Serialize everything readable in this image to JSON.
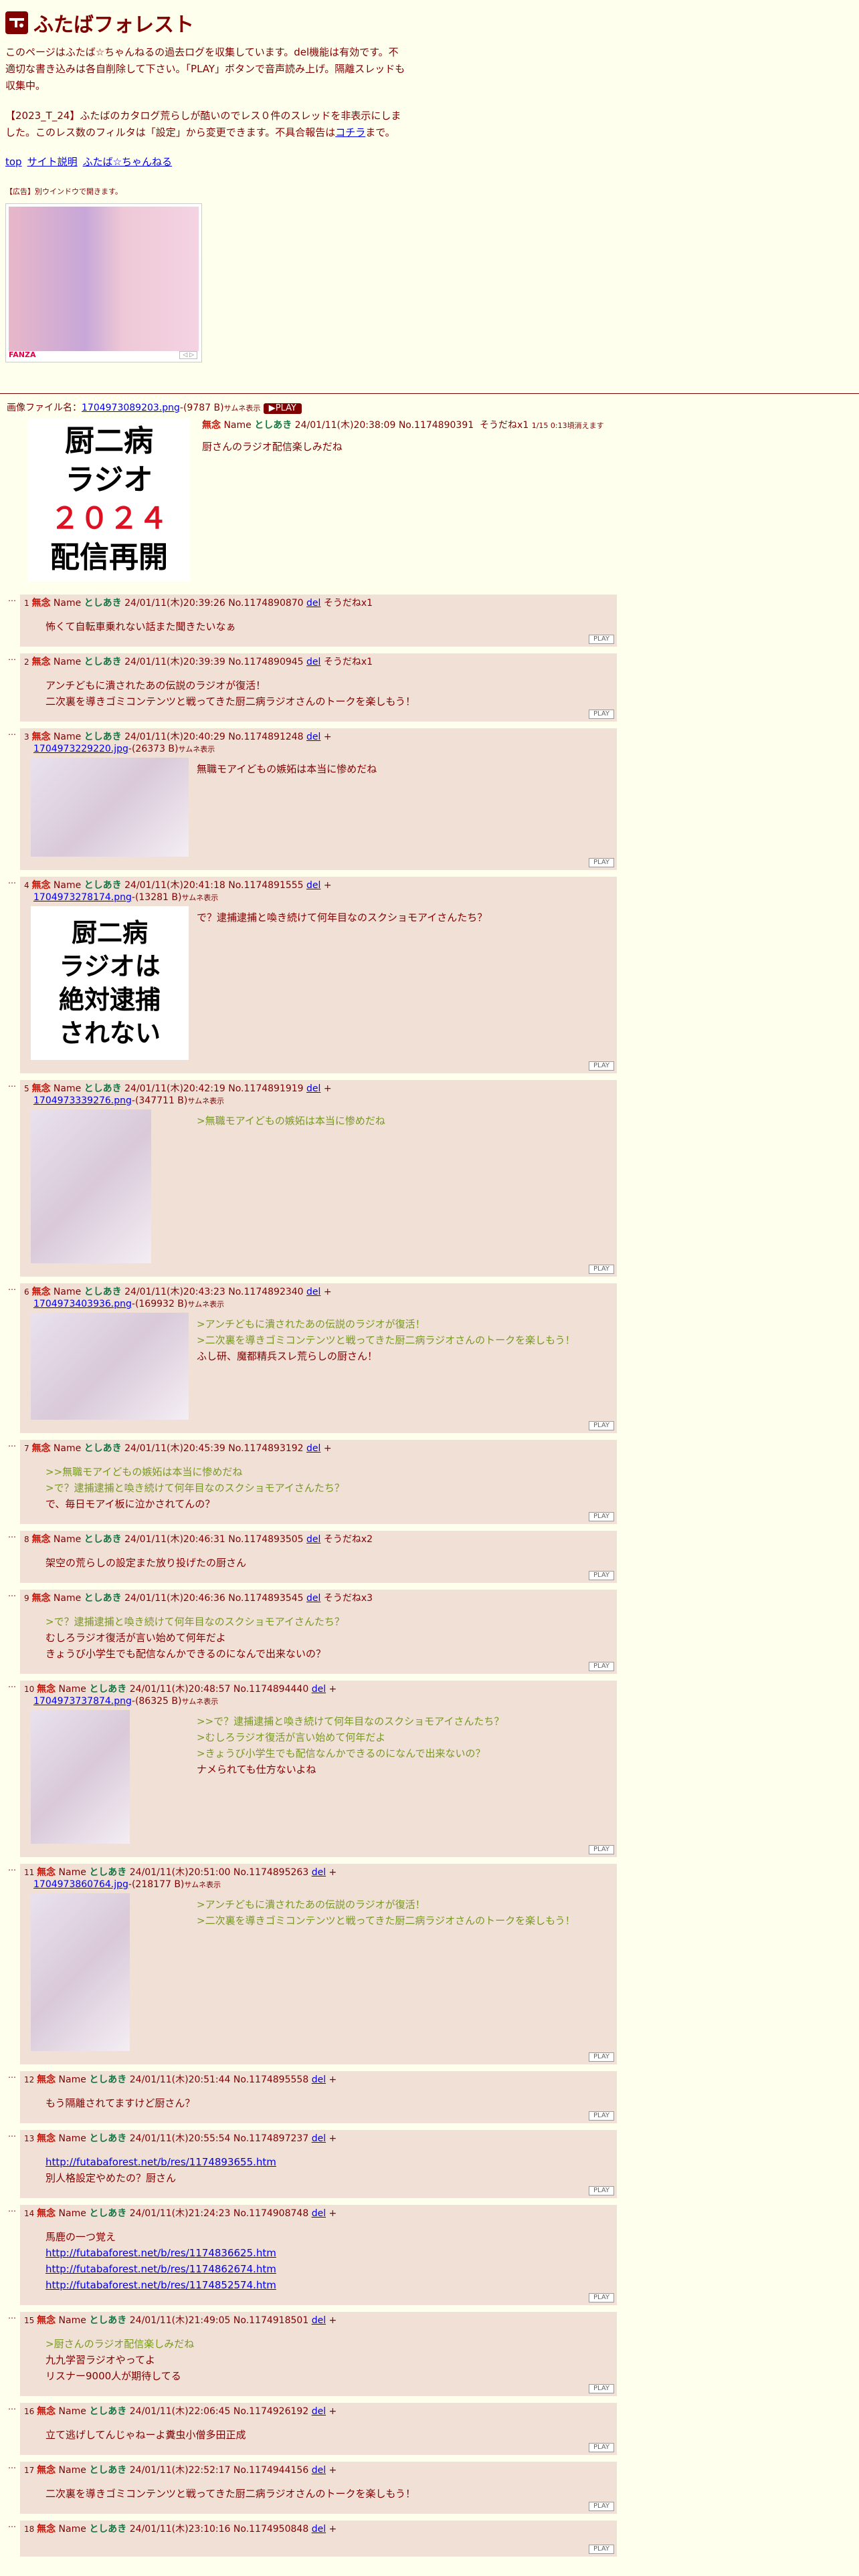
{
  "header": {
    "title": "ふたばフォレスト",
    "intro": "このページはふたば☆ちゃんねるの過去ログを収集しています。del機能は有効です。不適切な書き込みは各自削除して下さい。「PLAY」ボタンで音声読み上げ。隔離スレッドも収集中。",
    "notice": "【2023_T_24】ふたばのカタログ荒らしが酷いのでレス０件のスレッドを非表示にしました。このレス数のフィルタは「設定」から変更できます。不具合報告は",
    "notice_link": "コチラ",
    "notice_end": "まで。",
    "links": [
      "top",
      "サイト説明",
      "ふたば☆ちゃんねる"
    ],
    "ad_label": "【広告】別ウインドウで開きます。",
    "ad_brand": "FANZA"
  },
  "op": {
    "file_label": "画像ファイル名：",
    "file": "1704973089203.png",
    "file_meta": "-(9787 B)",
    "thumb_label": "サムネ表示",
    "play": "▶PLAY",
    "image_lines": [
      "厨二病",
      "ラジオ",
      "２０２４",
      "配信再開"
    ],
    "subject": "無念",
    "name_label": "Name",
    "name": "としあき",
    "date": "24/01/11(木)20:38:09",
    "no": "No.1174890391",
    "sodane": "そうだねx1",
    "expire": "1/15 0:13頃消えます",
    "body": "厨さんのラジオ配信楽しみだね"
  },
  "replies": [
    {
      "n": "1",
      "date": "24/01/11(木)20:39:26",
      "no": "No.1174890870",
      "sodane": "そうだねx1",
      "lines": [
        {
          "t": "怖くて自転車乗れない話また聞きたいなぁ",
          "q": false
        }
      ]
    },
    {
      "n": "2",
      "date": "24/01/11(木)20:39:39",
      "no": "No.1174890945",
      "sodane": "そうだねx1",
      "lines": [
        {
          "t": "アンチどもに潰されたあの伝説のラジオが復活！",
          "q": false
        },
        {
          "t": "二次裏を導きゴミコンテンツと戦ってきた厨二病ラジオさんのトークを楽しもう！",
          "q": false
        }
      ]
    },
    {
      "n": "3",
      "date": "24/01/11(木)20:40:29",
      "no": "No.1174891248",
      "sodane": "+",
      "file": "1704973229220.jpg",
      "meta": "-(26373 B)",
      "lines": [
        {
          "t": "無職モアイどもの嫉妬は本当に惨めだね",
          "q": false
        }
      ]
    },
    {
      "n": "4",
      "date": "24/01/11(木)20:41:18",
      "no": "No.1174891555",
      "sodane": "+",
      "file": "1704973278174.png",
      "meta": "-(13281 B)",
      "img": [
        "厨二病",
        "ラジオは",
        "絶対逮捕",
        "されない"
      ],
      "lines": [
        {
          "t": "で？逮捕逮捕と喚き続けて何年目なのスクショモアイさんたち？",
          "q": false
        }
      ]
    },
    {
      "n": "5",
      "date": "24/01/11(木)20:42:19",
      "no": "No.1174891919",
      "sodane": "+",
      "file": "1704973339276.png",
      "meta": "-(347711 B)",
      "lines": [
        {
          "t": ">無職モアイどもの嫉妬は本当に惨めだね",
          "q": true
        }
      ]
    },
    {
      "n": "6",
      "date": "24/01/11(木)20:43:23",
      "no": "No.1174892340",
      "sodane": "+",
      "file": "1704973403936.png",
      "meta": "-(169932 B)",
      "lines": [
        {
          "t": ">アンチどもに潰されたあの伝説のラジオが復活！",
          "q": true
        },
        {
          "t": ">二次裏を導きゴミコンテンツと戦ってきた厨二病ラジオさんのトークを楽しもう！",
          "q": true
        },
        {
          "t": "ふし研、魔都精兵スレ荒らしの厨さん！",
          "q": false
        }
      ]
    },
    {
      "n": "7",
      "date": "24/01/11(木)20:45:39",
      "no": "No.1174893192",
      "sodane": "+",
      "lines": [
        {
          "t": ">>無職モアイどもの嫉妬は本当に惨めだね",
          "q": true
        },
        {
          "t": ">で？逮捕逮捕と喚き続けて何年目なのスクショモアイさんたち？",
          "q": true
        },
        {
          "t": "で、毎日モアイ板に泣かされてんの？",
          "q": false
        }
      ]
    },
    {
      "n": "8",
      "date": "24/01/11(木)20:46:31",
      "no": "No.1174893505",
      "sodane": "そうだねx2",
      "lines": [
        {
          "t": "架空の荒らしの設定また放り投げたの厨さん",
          "q": false
        }
      ]
    },
    {
      "n": "9",
      "date": "24/01/11(木)20:46:36",
      "no": "No.1174893545",
      "sodane": "そうだねx3",
      "lines": [
        {
          "t": ">で？逮捕逮捕と喚き続けて何年目なのスクショモアイさんたち？",
          "q": true
        },
        {
          "t": "むしろラジオ復活が言い始めて何年だよ",
          "q": false
        },
        {
          "t": "きょうび小学生でも配信なんかできるのになんで出来ないの？",
          "q": false
        }
      ]
    },
    {
      "n": "10",
      "date": "24/01/11(木)20:48:57",
      "no": "No.1174894440",
      "sodane": "+",
      "file": "1704973737874.png",
      "meta": "-(86325 B)",
      "lines": [
        {
          "t": ">>で？逮捕逮捕と喚き続けて何年目なのスクショモアイさんたち？",
          "q": true
        },
        {
          "t": ">むしろラジオ復活が言い始めて何年だよ",
          "q": true
        },
        {
          "t": ">きょうび小学生でも配信なんかできるのになんで出来ないの？",
          "q": true
        },
        {
          "t": "ナメられても仕方ないよね",
          "q": false
        }
      ]
    },
    {
      "n": "11",
      "date": "24/01/11(木)20:51:00",
      "no": "No.1174895263",
      "sodane": "+",
      "file": "1704973860764.jpg",
      "meta": "-(218177 B)",
      "lines": [
        {
          "t": ">アンチどもに潰されたあの伝説のラジオが復活！",
          "q": true
        },
        {
          "t": ">二次裏を導きゴミコンテンツと戦ってきた厨二病ラジオさんのトークを楽しもう！",
          "q": true
        }
      ]
    },
    {
      "n": "12",
      "date": "24/01/11(木)20:51:44",
      "no": "No.1174895558",
      "sodane": "+",
      "lines": [
        {
          "t": "もう隔離されてますけど厨さん？",
          "q": false
        }
      ]
    },
    {
      "n": "13",
      "date": "24/01/11(木)20:55:54",
      "no": "No.1174897237",
      "sodane": "+",
      "lines": [
        {
          "t": "http://futabaforest.net/b/res/1174893655.htm",
          "q": false,
          "link": true
        },
        {
          "t": "別人格設定やめたの？厨さん",
          "q": false
        }
      ]
    },
    {
      "n": "14",
      "date": "24/01/11(木)21:24:23",
      "no": "No.1174908748",
      "sodane": "+",
      "lines": [
        {
          "t": "馬鹿の一つ覚え",
          "q": false
        },
        {
          "t": "http://futabaforest.net/b/res/1174836625.htm",
          "q": false,
          "link": true
        },
        {
          "t": "http://futabaforest.net/b/res/1174862674.htm",
          "q": false,
          "link": true
        },
        {
          "t": "http://futabaforest.net/b/res/1174852574.htm",
          "q": false,
          "link": true
        }
      ]
    },
    {
      "n": "15",
      "date": "24/01/11(木)21:49:05",
      "no": "No.1174918501",
      "sodane": "+",
      "lines": [
        {
          "t": ">厨さんのラジオ配信楽しみだね",
          "q": true
        },
        {
          "t": "九九学習ラジオやってよ",
          "q": false
        },
        {
          "t": "リスナー9000人が期待してる",
          "q": false
        }
      ]
    },
    {
      "n": "16",
      "date": "24/01/11(木)22:06:45",
      "no": "No.1174926192",
      "sodane": "+",
      "lines": [
        {
          "t": "立て逃げしてんじゃねーよ糞虫小僧多田正成",
          "q": false
        }
      ]
    },
    {
      "n": "17",
      "date": "24/01/11(木)22:52:17",
      "no": "No.1174944156",
      "sodane": "+",
      "lines": [
        {
          "t": "二次裏を導きゴミコンテンツと戦ってきた厨二病ラジオさんのトークを楽しもう！",
          "q": false
        }
      ]
    },
    {
      "n": "18",
      "date": "24/01/11(木)23:10:16",
      "no": "No.1174950848",
      "sodane": "+",
      "lines": []
    }
  ],
  "common": {
    "subject": "無念",
    "name_label": "Name",
    "name": "としあき",
    "del": "del",
    "thumb": "サムネ表示",
    "play": "PLAY",
    "dots": "…"
  },
  "colors": {
    "bg": "#ffffee",
    "reply_bg": "#f0e0d6",
    "text": "#800000",
    "quote": "#789922",
    "subject": "#cc1105",
    "name": "#117743"
  }
}
